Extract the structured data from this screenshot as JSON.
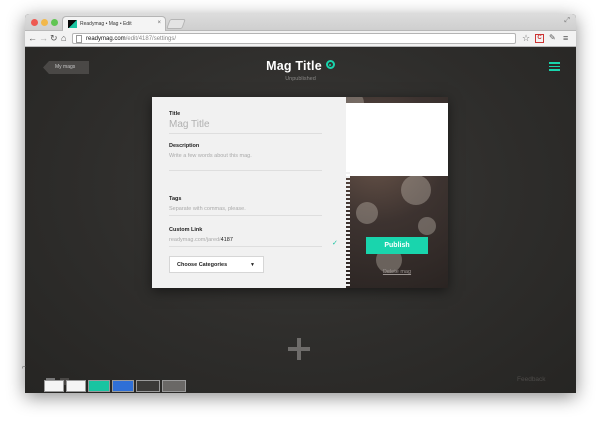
{
  "browser": {
    "tab_title": "Readymag • Mag • Edit",
    "tab_close": "×",
    "url_host": "readymag.com",
    "url_path": "/edit/4187/settings/",
    "nav": {
      "back": "←",
      "forward": "→",
      "reload": "↻",
      "home": "⌂"
    },
    "icons": {
      "star": "☆",
      "extension": "C",
      "wrench": "✎",
      "menu": "≡",
      "resize": "⤢"
    }
  },
  "editor": {
    "back_label": "My mags",
    "title": "Mag Title",
    "status": "Unpublished",
    "feedback": "Feedback",
    "accent_color": "#19d5ad"
  },
  "settings": {
    "title_label": "Title",
    "title_placeholder": "Mag Title",
    "description_label": "Description",
    "description_placeholder": "Write a few words about this mag.",
    "tags_label": "Tags",
    "tags_placeholder": "Separate with commas, please.",
    "link_label": "Custom Link",
    "link_prefix": "readymag.com/jared/",
    "link_slug": "4187",
    "check_icon": "✓",
    "categories_label": "Choose Categories",
    "caret": "▼",
    "publish_label": "Publish",
    "delete_label": "Delete mag"
  }
}
